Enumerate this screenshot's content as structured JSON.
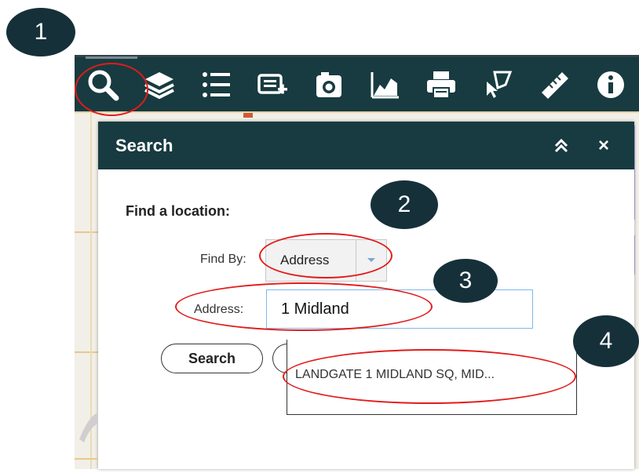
{
  "steps": [
    "1",
    "2",
    "3",
    "4"
  ],
  "toolbar": {
    "tools": [
      {
        "icon": "search-icon"
      },
      {
        "icon": "layers-icon"
      },
      {
        "icon": "legend-list-icon"
      },
      {
        "icon": "add-data-icon"
      },
      {
        "icon": "camera-icon"
      },
      {
        "icon": "chart-icon"
      },
      {
        "icon": "print-icon"
      },
      {
        "icon": "select-features-icon"
      },
      {
        "icon": "measure-ruler-icon"
      },
      {
        "icon": "info-icon"
      }
    ]
  },
  "panel": {
    "title": "Search",
    "close_glyph": "×",
    "find_heading": "Find a location:",
    "find_by_label": "Find By:",
    "find_by_value": "Address",
    "address_label": "Address:",
    "address_value": "1 Midland",
    "search_button": "Search",
    "suggestion": "LANDGATE 1 MIDLAND SQ, MID..."
  },
  "colors": {
    "toolbar_bg": "#173b40",
    "step_bg": "#16303a",
    "annotation": "#e21b1b",
    "input_border": "#7eb8ea"
  }
}
